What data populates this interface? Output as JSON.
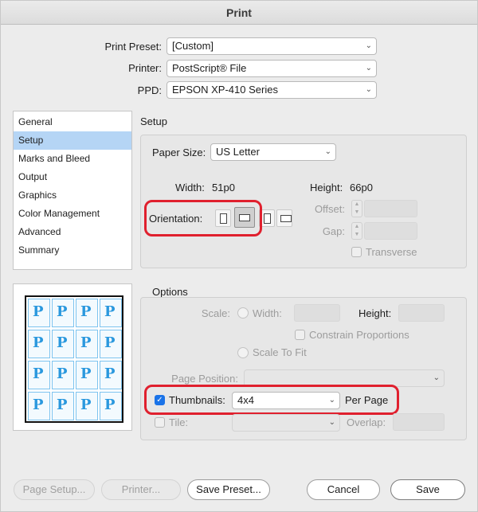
{
  "window": {
    "title": "Print"
  },
  "top": {
    "print_preset_label": "Print Preset:",
    "print_preset_value": "[Custom]",
    "printer_label": "Printer:",
    "printer_value": "PostScript® File",
    "ppd_label": "PPD:",
    "ppd_value": "EPSON XP-410 Series"
  },
  "sidebar": {
    "items": [
      {
        "label": "General"
      },
      {
        "label": "Setup"
      },
      {
        "label": "Marks and Bleed"
      },
      {
        "label": "Output"
      },
      {
        "label": "Graphics"
      },
      {
        "label": "Color Management"
      },
      {
        "label": "Advanced"
      },
      {
        "label": "Summary"
      }
    ],
    "selected": "Setup"
  },
  "setup": {
    "heading": "Setup",
    "paper_size_label": "Paper Size:",
    "paper_size_value": "US Letter",
    "width_label": "Width:",
    "width_value": "51p0",
    "height_label": "Height:",
    "height_value": "66p0",
    "orientation_label": "Orientation:",
    "offset_label": "Offset:",
    "gap_label": "Gap:",
    "transverse_label": "Transverse"
  },
  "options": {
    "heading": "Options",
    "scale_label": "Scale:",
    "width_label": "Width:",
    "height_label": "Height:",
    "constrain_label": "Constrain Proportions",
    "scale_to_fit_label": "Scale To Fit",
    "page_position_label": "Page Position:",
    "thumbnails_label": "Thumbnails:",
    "thumbnails_value": "4x4",
    "per_page_label": "Per Page",
    "tile_label": "Tile:",
    "overlap_label": "Overlap:"
  },
  "preview": {
    "cell_glyph": "P"
  },
  "buttons": {
    "page_setup": "Page Setup...",
    "printer": "Printer...",
    "save_preset": "Save Preset...",
    "cancel": "Cancel",
    "save": "Save"
  },
  "colors": {
    "accent": "#1a73e8",
    "highlight": "#e0202e",
    "sidebar_selected": "#b5d5f5",
    "thumb_glyph": "#2a98de"
  }
}
